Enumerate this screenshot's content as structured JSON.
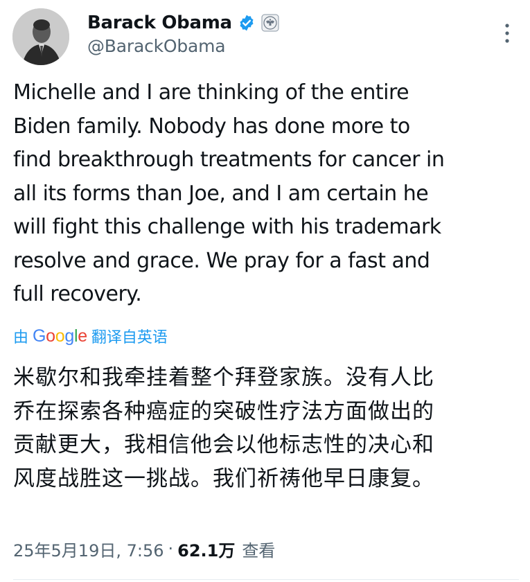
{
  "author": {
    "display_name": "Barack Obama",
    "handle": "@BarackObama",
    "verified_badge_icon": "verified-check-icon",
    "affiliation_icon": "presidential-seal-icon",
    "verified_color": "#1d9bf0"
  },
  "tweet": {
    "text": "Michelle and I are thinking of the entire\nBiden family. Nobody has done more to\nfind breakthrough treatments for cancer in\nall its forms than Joe, and I am certain he\nwill fight this challenge with his trademark\nresolve and grace. We pray for a fast and\nfull recovery.",
    "translation_prefix": "由",
    "translation_provider": "Google",
    "translation_suffix": "翻译自英语",
    "translated_text": "米歇尔和我牵挂着整个拜登家族。没有人比\n乔在探索各种癌症的突破性疗法方面做出的\n贡献更大，我相信他会以他标志性的决心和\n风度战胜这一挑战。我们祈祷他早日康复。",
    "timestamp": "25年5月19日, 7:56",
    "separator": "·",
    "views_count": "62.1万",
    "views_label": "查看"
  },
  "colors": {
    "text": "#0f1419",
    "secondary": "#536471",
    "link": "#1d9bf0"
  }
}
